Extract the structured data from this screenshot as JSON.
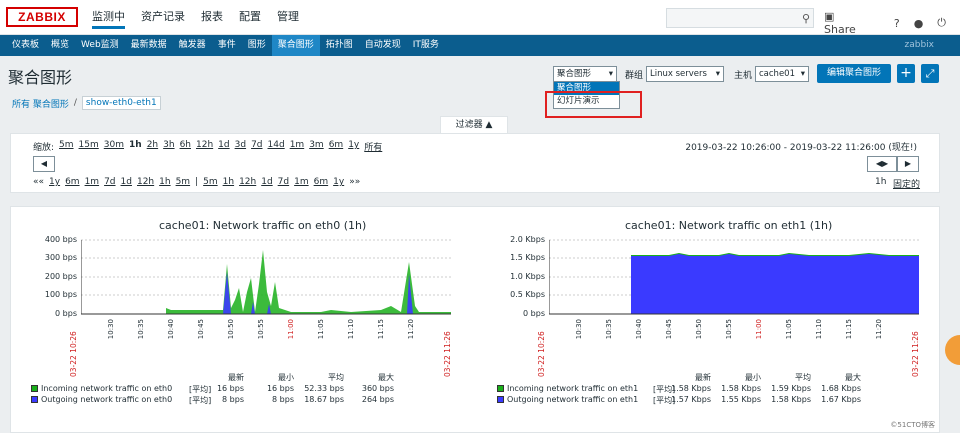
{
  "header": {
    "logo": "ZABBIX",
    "nav": [
      "监测中",
      "资产记录",
      "报表",
      "配置",
      "管理"
    ],
    "share": "Share",
    "help": "?"
  },
  "subnav": {
    "items": [
      "仪表板",
      "概览",
      "Web监测",
      "最新数据",
      "触发器",
      "事件",
      "图形",
      "聚合图形",
      "拓扑图",
      "自动发现",
      "IT服务"
    ],
    "user": "zabbix"
  },
  "page": {
    "title": "聚合图形",
    "select_value": "聚合图形",
    "group_label": "群组",
    "group_value": "Linux servers",
    "host_label": "主机",
    "host_value": "cache01",
    "edit_button": "编辑聚合图形",
    "dropdown": [
      "聚合图形",
      "幻灯片演示"
    ]
  },
  "breadcrumb": {
    "root": "所有 聚合图形",
    "current": "show-eth0-eth1"
  },
  "filter": {
    "tab": "过滤器 ▲",
    "zoom_label": "缩放:",
    "zoom": [
      "5m",
      "15m",
      "30m",
      "1h",
      "2h",
      "3h",
      "6h",
      "12h",
      "1d",
      "3d",
      "7d",
      "14d",
      "1m",
      "3m",
      "6m",
      "1y",
      "所有"
    ],
    "date_range": "2019-03-22 10:26:00 - 2019-03-22 11:26:00 (现在!)",
    "nav": [
      "«« ",
      "1y",
      "6m",
      "1m",
      "7d",
      "1d",
      "12h",
      "1h",
      "5m",
      "|",
      "5m",
      "1h",
      "12h",
      "1d",
      "7d",
      "1m",
      "6m",
      "1y",
      "»»"
    ],
    "right_1h": "1h",
    "fixed": "固定的"
  },
  "graph1": {
    "title": "cache01: Network traffic on eth0 (1h)",
    "y": [
      "400 bps",
      "300 bps",
      "200 bps",
      "100 bps",
      "0 bps"
    ],
    "x": [
      "10:30",
      "10:35",
      "10:40",
      "10:45",
      "10:50",
      "10:55",
      "11:00",
      "11:05",
      "11:10",
      "11:15",
      "11:20"
    ],
    "start": "03-22 10:26",
    "end": "03-22 11:26",
    "stat_headers": [
      "最新",
      "最小",
      "平均",
      "最大"
    ],
    "rows": [
      {
        "name": "Incoming network traffic on eth0",
        "tag": "[平均]",
        "last": "16 bps",
        "min": "16 bps",
        "avg": "52.33 bps",
        "max": "360 bps"
      },
      {
        "name": "Outgoing network traffic on eth0",
        "tag": "[平均]",
        "last": "8 bps",
        "min": "8 bps",
        "avg": "18.67 bps",
        "max": "264 bps"
      }
    ]
  },
  "graph2": {
    "title": "cache01: Network traffic on eth1 (1h)",
    "y": [
      "2.0 Kbps",
      "1.5 Kbps",
      "1.0 Kbps",
      "0.5 Kbps",
      "0 bps"
    ],
    "x": [
      "10:30",
      "10:35",
      "10:40",
      "10:45",
      "10:50",
      "10:55",
      "11:00",
      "11:05",
      "11:10",
      "11:15",
      "11:20"
    ],
    "start": "03-22 10:26",
    "end": "03-22 11:26",
    "stat_headers": [
      "最新",
      "最小",
      "平均",
      "最大"
    ],
    "rows": [
      {
        "name": "Incoming network traffic on eth1",
        "tag": "[平均]",
        "last": "1.58 Kbps",
        "min": "1.58 Kbps",
        "avg": "1.59 Kbps",
        "max": "1.68 Kbps"
      },
      {
        "name": "Outgoing network traffic on eth1",
        "tag": "[平均]",
        "last": "1.57 Kbps",
        "min": "1.55 Kbps",
        "avg": "1.58 Kbps",
        "max": "1.67 Kbps"
      }
    ]
  },
  "watermark": "©51CTO博客",
  "colors": {
    "incoming": "#1aaf1a",
    "outgoing": "#3a3aff",
    "accent": "#0275b8"
  }
}
